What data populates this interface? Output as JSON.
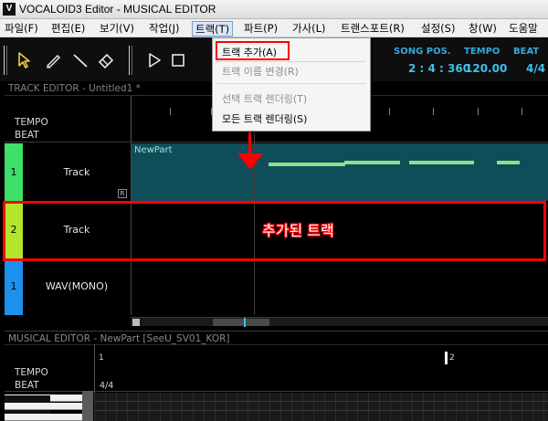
{
  "window": {
    "title": "VOCALOID3 Editor - MUSICAL EDITOR",
    "app_icon_glyph": "V"
  },
  "menubar": {
    "items": [
      {
        "label": "파일(F)"
      },
      {
        "label": "편집(E)"
      },
      {
        "label": "보기(V)"
      },
      {
        "label": "작업(J)"
      },
      {
        "label": "트랙(T)",
        "open": true
      },
      {
        "label": "파트(P)"
      },
      {
        "label": "가사(L)"
      },
      {
        "label": "트랜스포트(R)"
      },
      {
        "label": "설정(S)"
      },
      {
        "label": "창(W)"
      },
      {
        "label": "도움말"
      }
    ]
  },
  "toolbar": {
    "tools": [
      "pointer-icon",
      "pencil-icon",
      "line-icon",
      "eraser-icon",
      "play-icon",
      "stop-icon"
    ],
    "song_pos_label": "SONG POS.",
    "song_pos_value": "2 : 4 : 360",
    "tempo_label": "TEMPO",
    "tempo_value": "120.00",
    "beat_label": "BEAT",
    "beat_value": "4/4"
  },
  "track_menu": {
    "items": [
      {
        "label": "트랙 추가(A)",
        "enabled": true,
        "highlighted": true
      },
      {
        "label": "트랙 이름 변경(R)",
        "enabled": false
      },
      {
        "label": "선택 트랙 렌더링(T)",
        "enabled": false
      },
      {
        "label": "모든 트랙 렌더링(S)",
        "enabled": true
      }
    ]
  },
  "track_editor": {
    "title": "TRACK EDITOR - Untitled1 *",
    "tempo_label": "TEMPO",
    "beat_label": "BEAT",
    "tracks": [
      {
        "number": "1",
        "name": "Track",
        "color": "#3ee06a",
        "badge": "R"
      },
      {
        "number": "2",
        "name": "Track",
        "color": "#b4e52e"
      },
      {
        "number": "1",
        "name": "WAV(MONO)",
        "color": "#1e90ee"
      }
    ],
    "part": {
      "name": "NewPart"
    },
    "annotation": "추가된 트랙"
  },
  "musical_editor": {
    "title": "MUSICAL EDITOR - NewPart [SeeU_SV01_KOR]",
    "tempo_label": "TEMPO",
    "beat_label": "BEAT",
    "beat_value": "4/4",
    "measure_labels": [
      "1",
      "2"
    ]
  },
  "colors": {
    "accent_blue": "#3ec0ec",
    "part_fill": "#0f4d58",
    "note": "#8ce18c",
    "callout_red": "#ff0000"
  }
}
